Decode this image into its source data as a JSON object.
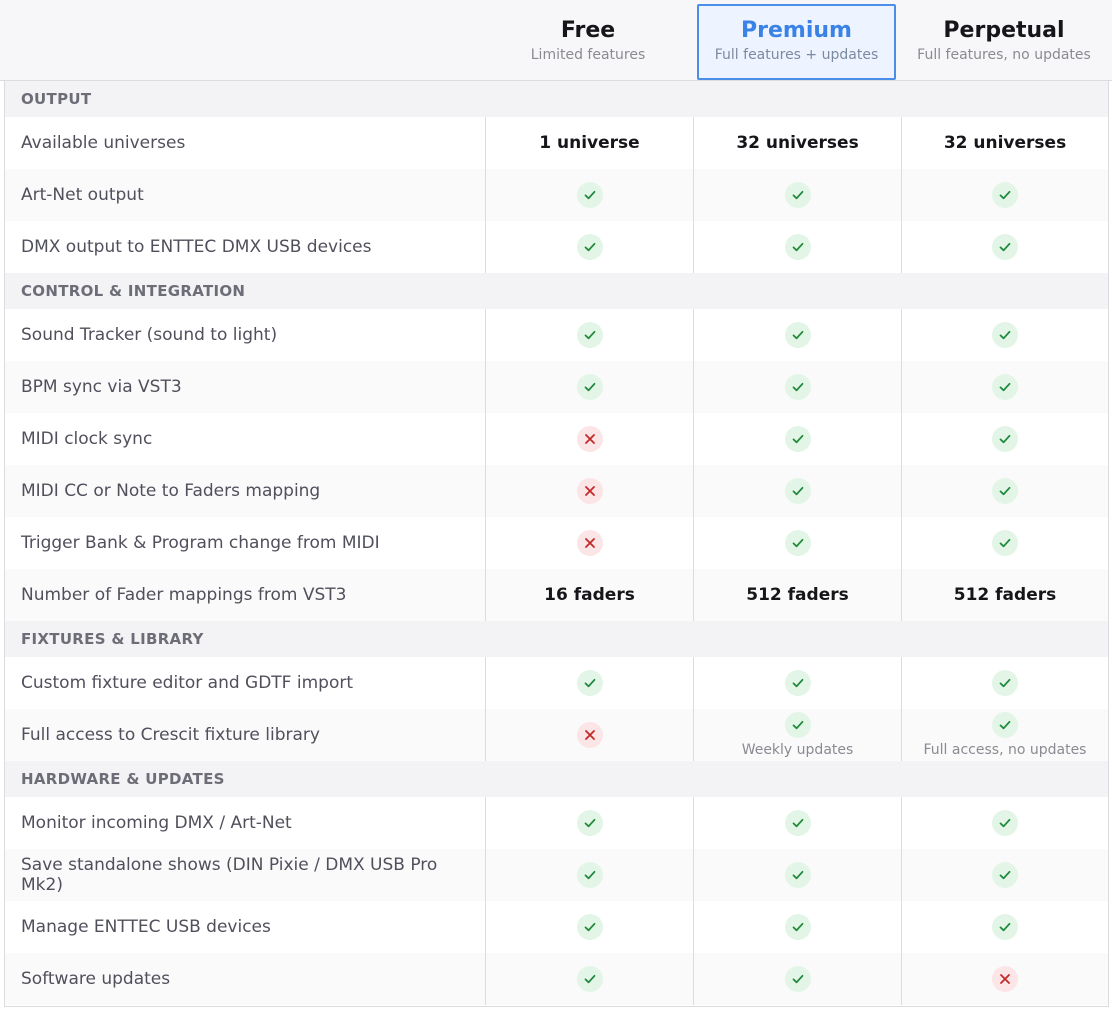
{
  "plans": [
    {
      "name": "Free",
      "desc": "Limited features"
    },
    {
      "name": "Premium",
      "desc": "Full features + updates"
    },
    {
      "name": "Perpetual",
      "desc": "Full features, no updates"
    }
  ],
  "colors": {
    "yes_icon": "#1f8a3a",
    "no_icon": "#c62828",
    "accent": "#3b82e6"
  },
  "rows": [
    {
      "type": "section",
      "title": "OUTPUT"
    },
    {
      "type": "feature",
      "label": "Available universes",
      "cells": [
        {
          "text": "1 universe"
        },
        {
          "text": "32 universes"
        },
        {
          "text": "32 universes"
        }
      ]
    },
    {
      "type": "feature",
      "label": "Art-Net output",
      "cells": [
        {
          "check": true
        },
        {
          "check": true
        },
        {
          "check": true
        }
      ]
    },
    {
      "type": "feature",
      "label": "DMX output to ENTTEC DMX USB devices",
      "cells": [
        {
          "check": true
        },
        {
          "check": true
        },
        {
          "check": true
        }
      ]
    },
    {
      "type": "section",
      "title": "CONTROL & INTEGRATION"
    },
    {
      "type": "feature",
      "label": "Sound Tracker (sound to light)",
      "cells": [
        {
          "check": true
        },
        {
          "check": true
        },
        {
          "check": true
        }
      ]
    },
    {
      "type": "feature",
      "label": "BPM sync via VST3",
      "cells": [
        {
          "check": true
        },
        {
          "check": true
        },
        {
          "check": true
        }
      ]
    },
    {
      "type": "feature",
      "label": "MIDI clock sync",
      "cells": [
        {
          "check": false
        },
        {
          "check": true
        },
        {
          "check": true
        }
      ]
    },
    {
      "type": "feature",
      "label": "MIDI CC or Note to Faders mapping",
      "cells": [
        {
          "check": false
        },
        {
          "check": true
        },
        {
          "check": true
        }
      ]
    },
    {
      "type": "feature",
      "label": "Trigger Bank & Program change from MIDI",
      "cells": [
        {
          "check": false
        },
        {
          "check": true
        },
        {
          "check": true
        }
      ]
    },
    {
      "type": "feature",
      "label": "Number of Fader mappings from VST3",
      "cells": [
        {
          "text": "16 faders"
        },
        {
          "text": "512 faders"
        },
        {
          "text": "512 faders"
        }
      ]
    },
    {
      "type": "section",
      "title": "FIXTURES & LIBRARY"
    },
    {
      "type": "feature",
      "label": "Custom fixture editor and GDTF import",
      "cells": [
        {
          "check": true
        },
        {
          "check": true
        },
        {
          "check": true
        }
      ]
    },
    {
      "type": "feature",
      "label": "Full access to Crescit fixture library",
      "cells": [
        {
          "check": false
        },
        {
          "check": true,
          "note": "Weekly updates"
        },
        {
          "check": true,
          "note": "Full access, no updates"
        }
      ]
    },
    {
      "type": "section",
      "title": "HARDWARE & UPDATES"
    },
    {
      "type": "feature",
      "label": "Monitor incoming DMX / Art-Net",
      "cells": [
        {
          "check": true
        },
        {
          "check": true
        },
        {
          "check": true
        }
      ]
    },
    {
      "type": "feature",
      "label": "Save standalone shows (DIN Pixie / DMX USB Pro Mk2)",
      "cells": [
        {
          "check": true
        },
        {
          "check": true
        },
        {
          "check": true
        }
      ]
    },
    {
      "type": "feature",
      "label": "Manage ENTTEC USB devices",
      "cells": [
        {
          "check": true
        },
        {
          "check": true
        },
        {
          "check": true
        }
      ]
    },
    {
      "type": "feature",
      "label": "Software updates",
      "cells": [
        {
          "check": true
        },
        {
          "check": true
        },
        {
          "check": false
        }
      ]
    }
  ]
}
